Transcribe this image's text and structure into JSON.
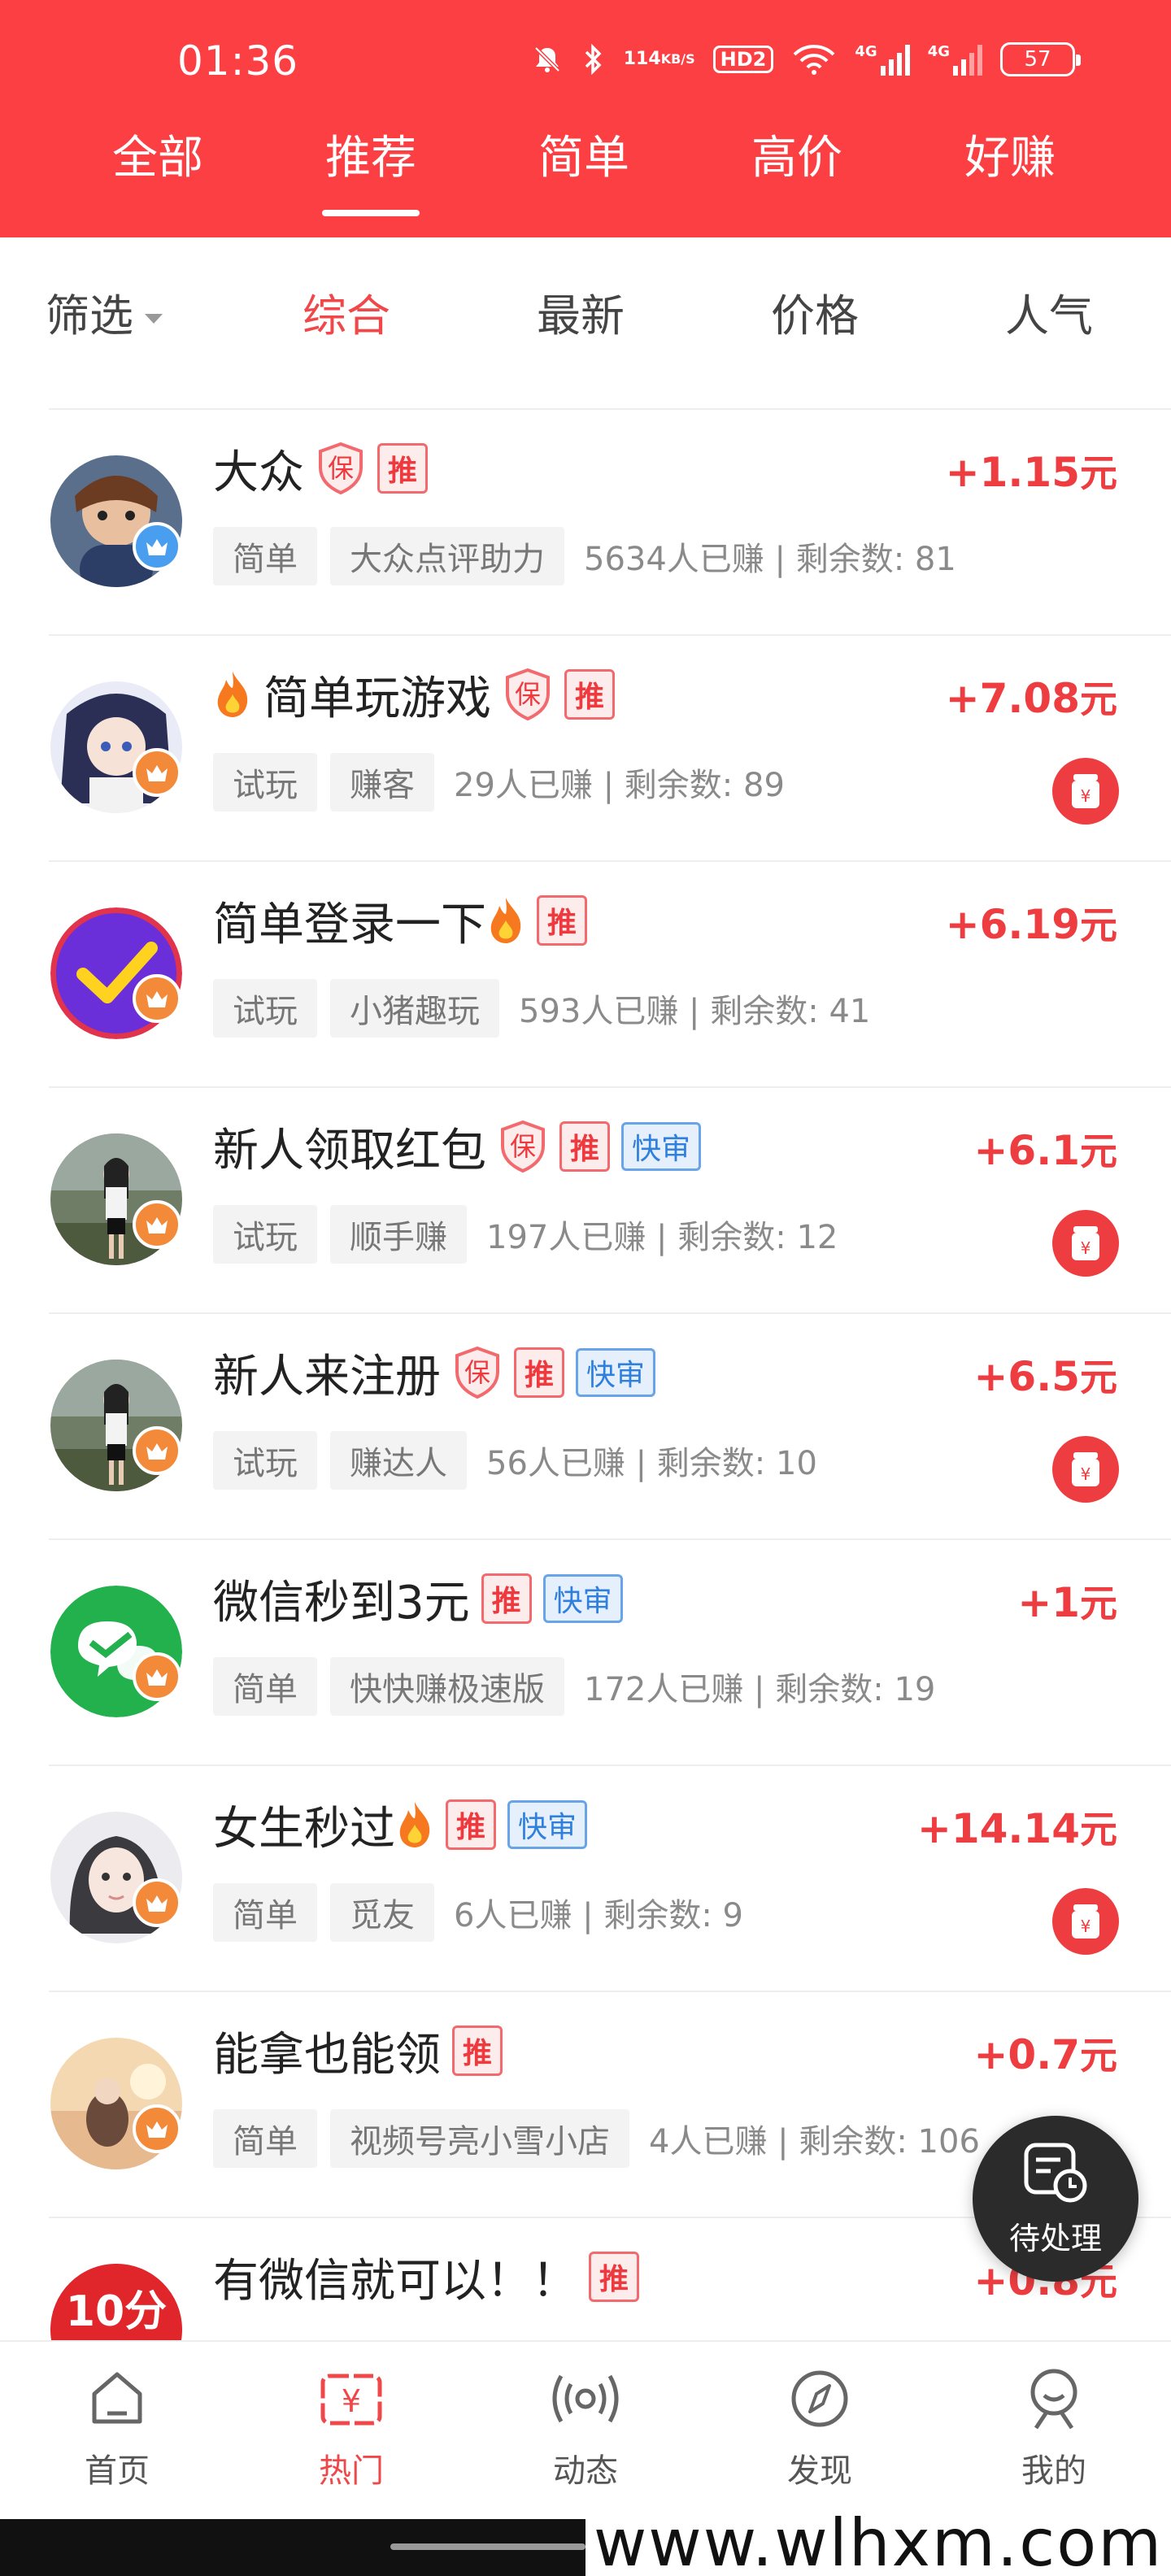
{
  "status_bar": {
    "time": "01:36",
    "net_speed_value": "114",
    "net_speed_unit": "KB/S",
    "hd_label": "HD2",
    "sig1_label": "4G",
    "sig2_label": "4G",
    "battery": "57"
  },
  "top_tabs": [
    "全部",
    "推荐",
    "简单",
    "高价",
    "好赚"
  ],
  "top_tab_active": "推荐",
  "filter": {
    "filter_label": "筛选",
    "sorts": [
      "综合",
      "最新",
      "价格",
      "人气"
    ],
    "active": "综合"
  },
  "tasks": [
    {
      "title": "大众",
      "fire": false,
      "bao": true,
      "tui": true,
      "kuai": false,
      "tag1": "简单",
      "tag2": "大众点评助力",
      "stats": "5634人已赚 | 剩余数: 81",
      "reward": "+1.15",
      "unit": "元",
      "coin": false
    },
    {
      "title": "简单玩游戏",
      "fire_prefix": true,
      "bao": true,
      "tui": true,
      "kuai": false,
      "tag1": "试玩",
      "tag2": "赚客",
      "stats": "29人已赚 | 剩余数: 89",
      "reward": "+7.08",
      "unit": "元",
      "coin": true
    },
    {
      "title": "简单登录一下",
      "fire": true,
      "bao": false,
      "tui": true,
      "kuai": false,
      "tag1": "试玩",
      "tag2": "小猪趣玩",
      "stats": "593人已赚 | 剩余数: 41",
      "reward": "+6.19",
      "unit": "元",
      "coin": false
    },
    {
      "title": "新人领取红包",
      "fire": false,
      "bao": true,
      "tui": true,
      "kuai": true,
      "tag1": "试玩",
      "tag2": "顺手赚",
      "stats": "197人已赚 | 剩余数: 12",
      "reward": "+6.1",
      "unit": "元",
      "coin": true
    },
    {
      "title": "新人来注册",
      "fire": false,
      "bao": true,
      "tui": true,
      "kuai": true,
      "tag1": "试玩",
      "tag2": "赚达人",
      "stats": "56人已赚 | 剩余数: 10",
      "reward": "+6.5",
      "unit": "元",
      "coin": true
    },
    {
      "title": "微信秒到3元",
      "fire": false,
      "bao": false,
      "tui": true,
      "kuai": true,
      "tag1": "简单",
      "tag2": "快快赚极速版",
      "stats": "172人已赚 | 剩余数: 19",
      "reward": "+1",
      "unit": "元",
      "coin": false
    },
    {
      "title": "女生秒过",
      "fire": true,
      "bao": false,
      "tui": true,
      "kuai": true,
      "tag1": "简单",
      "tag2": "觅友",
      "stats": "6人已赚 | 剩余数: 9",
      "reward": "+14.14",
      "unit": "元",
      "coin": true
    },
    {
      "title": "能拿也能领",
      "fire": false,
      "bao": false,
      "tui": true,
      "kuai": false,
      "tag1": "简单",
      "tag2": "视频号亮小雪小店",
      "stats": "4人已赚 | 剩余数: 106",
      "reward": "+0.7",
      "unit": "元",
      "coin": false
    },
    {
      "title": "有微信就可以！！",
      "fire": false,
      "bao": false,
      "tui": true,
      "kuai": false,
      "tag1": "",
      "tag2": "",
      "stats": "",
      "reward": "+0.8",
      "unit": "元",
      "coin": false,
      "avatar_text": "10分"
    }
  ],
  "badges": {
    "bao": "保",
    "tui": "推",
    "kuai": "快审"
  },
  "fab": {
    "label": "待处理"
  },
  "bottom_nav": [
    {
      "label": "首页",
      "icon": "home-icon"
    },
    {
      "label": "热门",
      "icon": "hot-yen-icon"
    },
    {
      "label": "动态",
      "icon": "broadcast-icon"
    },
    {
      "label": "发现",
      "icon": "compass-icon"
    },
    {
      "label": "我的",
      "icon": "profile-icon"
    }
  ],
  "bottom_nav_active": "热门",
  "watermark": "www.wlhxm.com",
  "colors": {
    "brand_red": "#fc3f43",
    "reward_red": "#ee3d40",
    "quick_blue": "#2f7fdc"
  }
}
